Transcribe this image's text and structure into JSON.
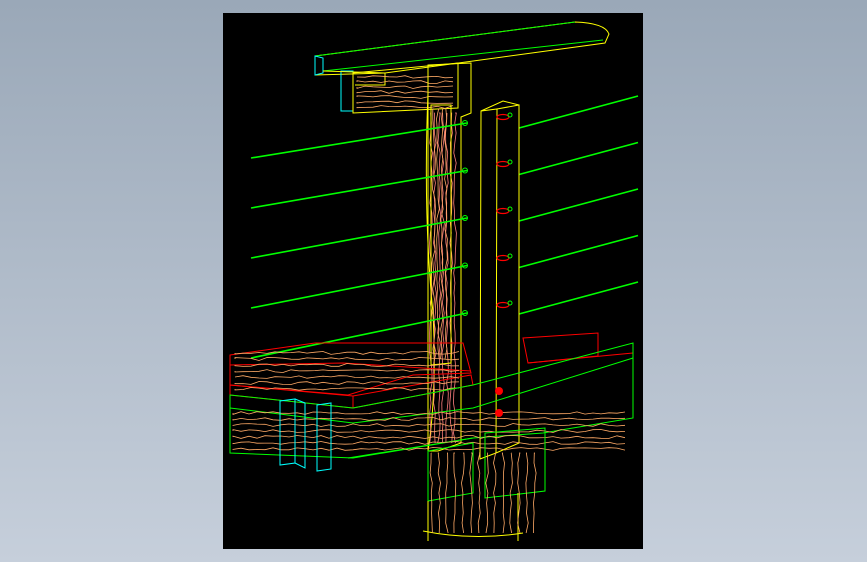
{
  "colors": {
    "background_top": "#9aa8b8",
    "background_bottom": "#c6cfdb",
    "viewport_background": "#000000",
    "outline_yellow": "#ffff00",
    "outline_red": "#ff0000",
    "outline_green": "#00ff00",
    "outline_cyan": "#00ffff",
    "wood_grain": "#ffaa66",
    "wood_grain_alt": "#ff7f7f"
  },
  "diagram": {
    "subject": "",
    "cable_count": 10,
    "fasteners_on_post": 5,
    "lag_bolts": 2
  }
}
